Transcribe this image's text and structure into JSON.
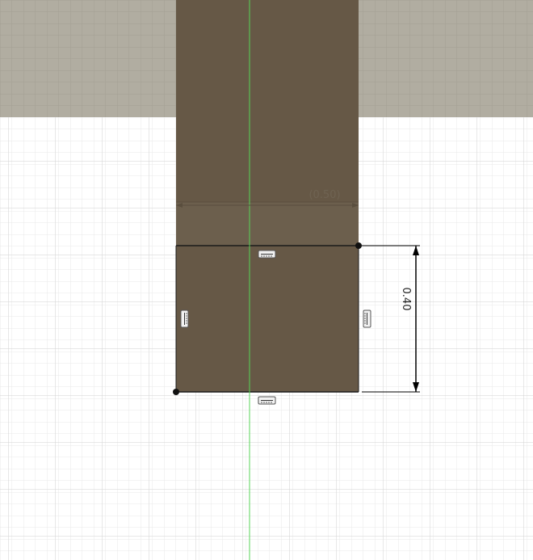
{
  "sketch": {
    "dimensions": {
      "reference_width": "(0.50)",
      "height": "0.40"
    },
    "colors": {
      "canvas": "#ffffff",
      "grid_minor": "#e6e6e6",
      "grid_major": "#d4d4d4",
      "ground_band": "#b0aca0",
      "body_fill": "#665846",
      "body_fill_dim": "#6b5e4c",
      "axis_line": "#57d357",
      "dimension_line": "#000000",
      "reference_text": "#6f6352"
    },
    "icons": [
      "horizontal-constraint-icon",
      "vertical-constraint-icon",
      "vertical-constraint-icon",
      "horizontal-constraint-icon"
    ]
  }
}
